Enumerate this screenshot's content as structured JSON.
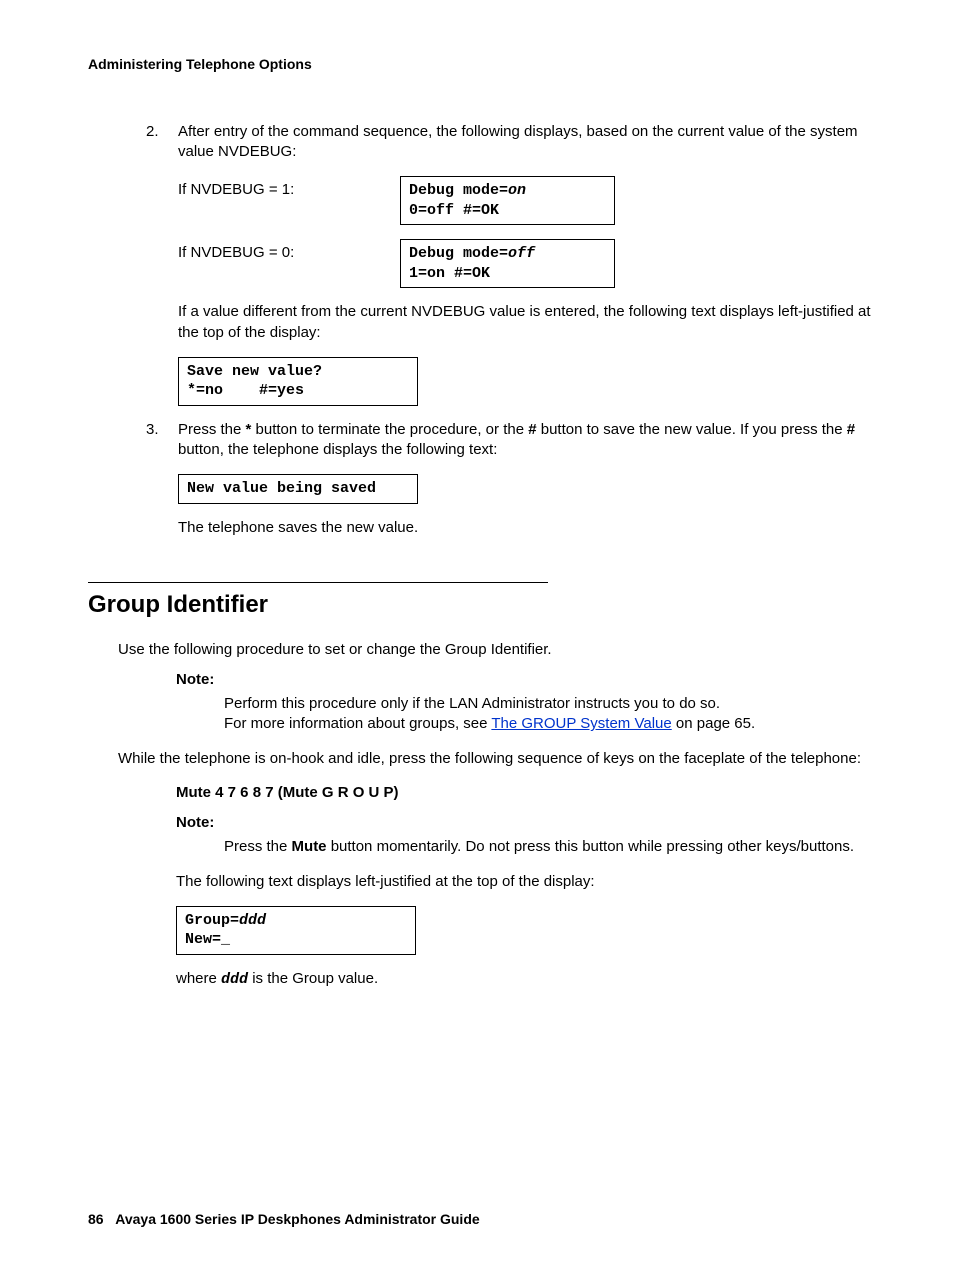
{
  "header": "Administering Telephone Options",
  "step2": {
    "num": "2.",
    "text": "After entry of the command sequence, the following displays, based on the current value of the system value NVDEBUG:",
    "row1_label": "If NVDEBUG = 1:",
    "row1_box_l1a": "Debug mode=",
    "row1_box_l1b": "on",
    "row1_box_l2": "0=off #=OK",
    "row2_label": "If NVDEBUG = 0:",
    "row2_box_l1a": "Debug mode=",
    "row2_box_l1b": "off",
    "row2_box_l2": "1=on #=OK",
    "after": "If a value different from the current NVDEBUG value is entered, the following text displays left-justified at the top of the display:",
    "savebox_l1": "Save new value?",
    "savebox_l2": "*=no    #=yes"
  },
  "step3": {
    "num": "3.",
    "t1": "Press the ",
    "t2": "*",
    "t3": " button to terminate the procedure, or the ",
    "t4": "#",
    "t5": " button to save the new value. If you press the ",
    "t6": "#",
    "t7": " button, the telephone displays the following text:",
    "box": "New value being saved",
    "after": "The telephone saves the new value."
  },
  "section_title": "Group Identifier",
  "gi": {
    "intro": "Use the following procedure to set or change the Group Identifier.",
    "note1_label": "Note:",
    "note1_l1": "Perform this procedure only if the LAN Administrator instructs you to do so.",
    "note1_l2a": "For more information about groups, see ",
    "note1_link": " The GROUP System Value",
    "note1_l2b": " on page 65.",
    "p2": "While the telephone is on-hook and idle, press the following sequence of keys on the faceplate of the telephone:",
    "mute": "Mute 4 7 6 8 7 (Mute G R O U P)",
    "note2_label": "Note:",
    "note2_a": "Press the ",
    "note2_b": "Mute",
    "note2_c": " button momentarily. Do not press this button while pressing other keys/buttons.",
    "p3": "The following text displays left-justified at the top of the display:",
    "box_l1a": "Group=",
    "box_l1b": "ddd",
    "box_l2": "New=_",
    "where_a": "where ",
    "where_b": "ddd",
    "where_c": " is the Group value."
  },
  "footer_page": "86",
  "footer_title": "Avaya 1600 Series IP Deskphones Administrator Guide"
}
